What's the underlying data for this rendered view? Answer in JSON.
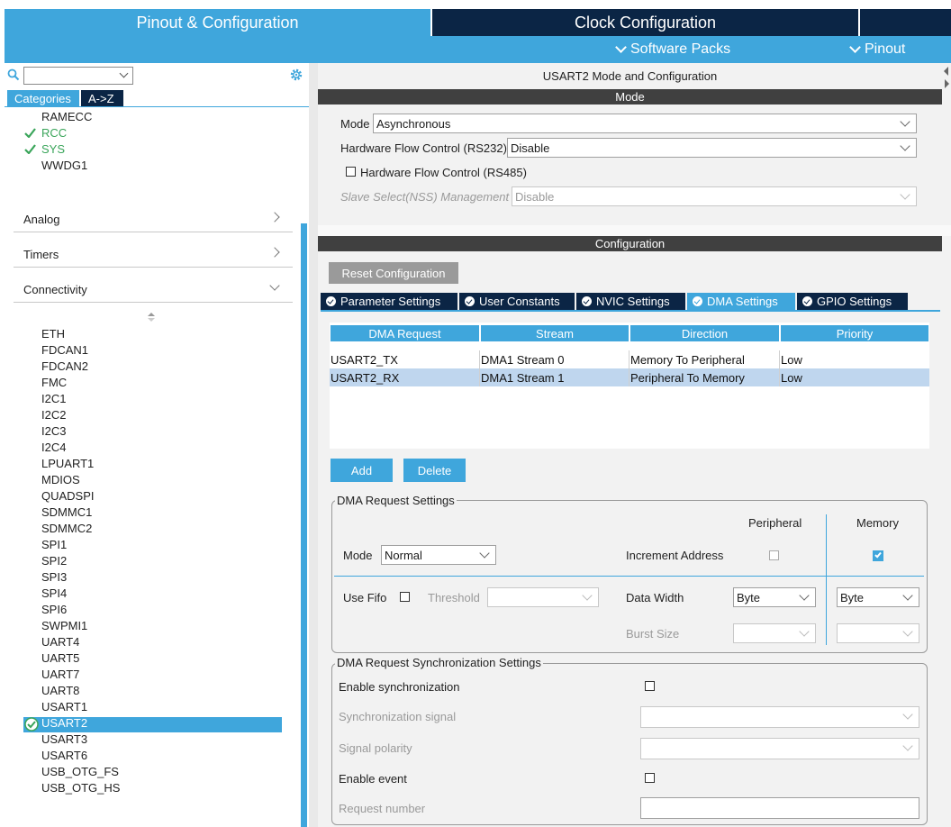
{
  "top_tabs": {
    "pinout_config": "Pinout & Configuration",
    "clock_config": "Clock Configuration"
  },
  "subbar": {
    "software_packs": "Software Packs",
    "pinout": "Pinout"
  },
  "left": {
    "search_value": "",
    "tab_categories": "Categories",
    "tab_az": "A->Z",
    "system_items": [
      "RAMECC",
      "RCC",
      "SYS",
      "WWDG1"
    ],
    "system_items_checked": [
      "RCC",
      "SYS"
    ],
    "sections": [
      "Analog",
      "Timers",
      "Connectivity"
    ],
    "connectivity_items": [
      "ETH",
      "FDCAN1",
      "FDCAN2",
      "FMC",
      "I2C1",
      "I2C2",
      "I2C3",
      "I2C4",
      "LPUART1",
      "MDIOS",
      "QUADSPI",
      "SDMMC1",
      "SDMMC2",
      "SPI1",
      "SPI2",
      "SPI3",
      "SPI4",
      "SPI6",
      "SWPMI1",
      "UART4",
      "UART5",
      "UART7",
      "UART8",
      "USART1",
      "USART2",
      "USART3",
      "USART6",
      "USB_OTG_FS",
      "USB_OTG_HS"
    ],
    "selected_item": "USART2"
  },
  "right": {
    "title": "USART2 Mode and Configuration",
    "mode_header": "Mode",
    "mode_label": "Mode",
    "mode_value": "Asynchronous",
    "hw_flow_rs232_label": "Hardware Flow Control (RS232)",
    "hw_flow_rs232_value": "Disable",
    "hw_flow_rs485_label": "Hardware Flow Control (RS485)",
    "slave_select_label": "Slave Select(NSS) Management",
    "slave_select_value": "Disable",
    "config_header": "Configuration",
    "reset_button": "Reset Configuration",
    "tabs": [
      "Parameter Settings",
      "User Constants",
      "NVIC Settings",
      "DMA Settings",
      "GPIO Settings"
    ],
    "active_tab": "DMA Settings",
    "dma_table": {
      "headers": [
        "DMA Request",
        "Stream",
        "Direction",
        "Priority"
      ],
      "rows": [
        [
          "USART2_TX",
          "DMA1 Stream 0",
          "Memory To Peripheral",
          "Low"
        ],
        [
          "USART2_RX",
          "DMA1 Stream 1",
          "Peripheral To Memory",
          "Low"
        ]
      ],
      "selected_row": 1
    },
    "add_button": "Add",
    "delete_button": "Delete",
    "dma_request_settings": {
      "title": "DMA Request Settings",
      "peripheral_header": "Peripheral",
      "memory_header": "Memory",
      "mode_label": "Mode",
      "mode_value": "Normal",
      "increment_address_label": "Increment Address",
      "peripheral_increment": false,
      "memory_increment": true,
      "use_fifo_label": "Use Fifo",
      "threshold_label": "Threshold",
      "threshold_value": "",
      "data_width_label": "Data Width",
      "peripheral_data_width": "Byte",
      "memory_data_width": "Byte",
      "burst_size_label": "Burst Size"
    },
    "sync_settings": {
      "title": "DMA Request Synchronization Settings",
      "enable_sync_label": "Enable synchronization",
      "sync_signal_label": "Synchronization signal",
      "signal_polarity_label": "Signal polarity",
      "enable_event_label": "Enable event",
      "request_number_label": "Request number"
    }
  },
  "colors": {
    "accent_blue": "#3fa6dc",
    "dark_navy": "#0b2545",
    "check_green": "#3aa55a",
    "selection_blue": "#3fa6dc",
    "row_select": "#bfd6ee"
  }
}
